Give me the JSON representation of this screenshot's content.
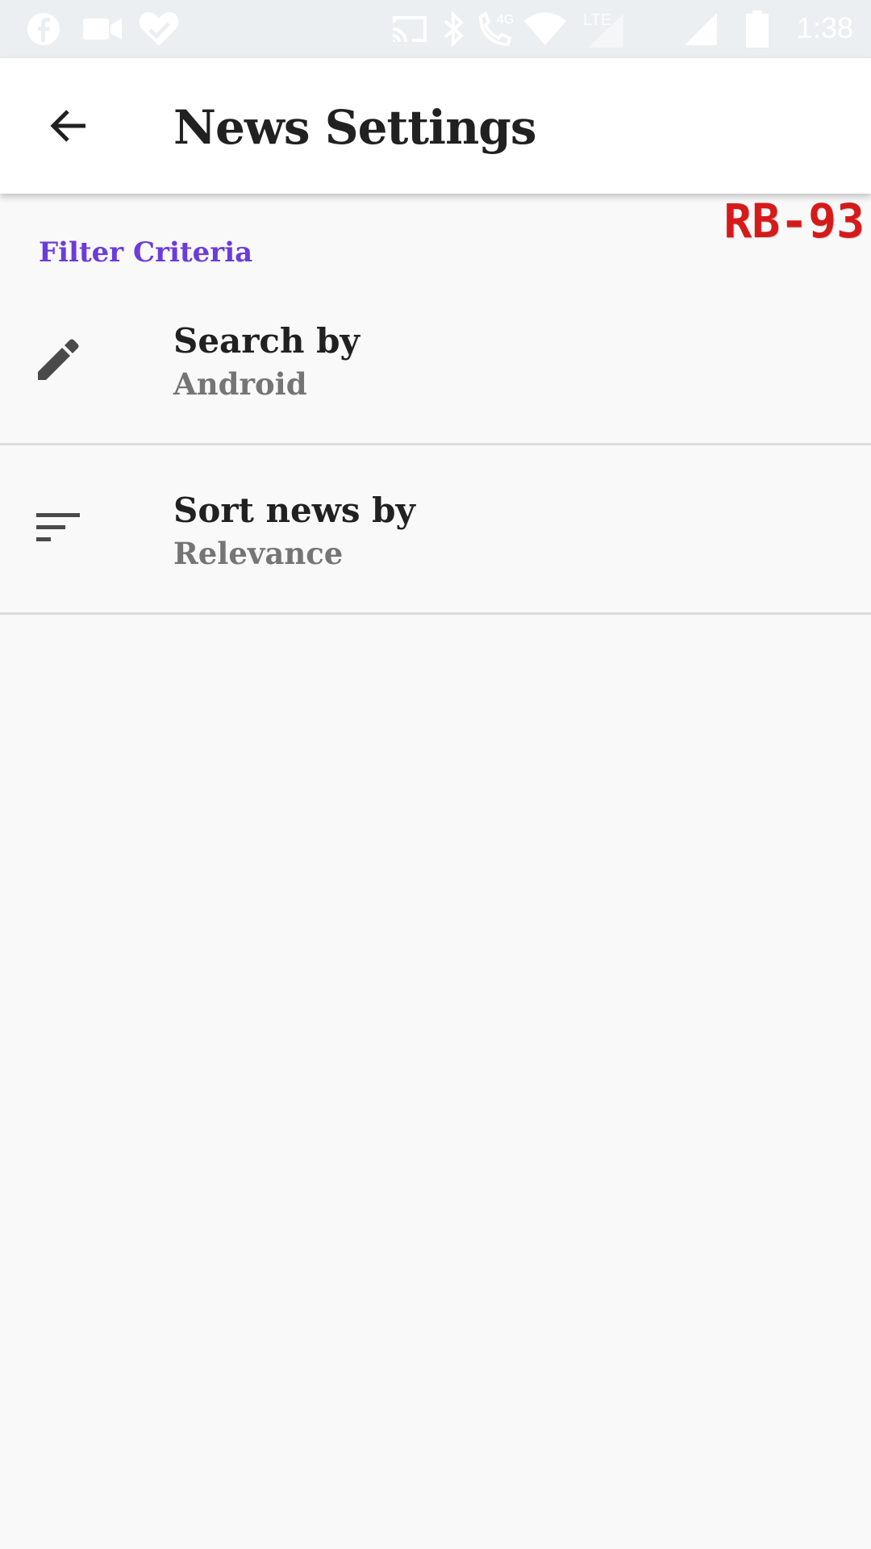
{
  "status_bar": {
    "time": "1:38",
    "network_label": "4G",
    "lte_label": "LTE",
    "icons": [
      "facebook-icon",
      "video-camera-icon",
      "heart-check-icon",
      "cast-icon",
      "bluetooth-icon",
      "wifi-calling-icon",
      "wifi-icon",
      "signal-icon",
      "signal-icon",
      "battery-icon"
    ]
  },
  "app_bar": {
    "title": "News Settings",
    "back_icon": "arrow-back-icon"
  },
  "watermark": "RB-93",
  "section": {
    "header": "Filter Criteria",
    "color": "#6b3cdb"
  },
  "preferences": [
    {
      "icon": "pencil-icon",
      "title": "Search by",
      "summary": "Android"
    },
    {
      "icon": "sort-icon",
      "title": "Sort news by",
      "summary": "Relevance"
    }
  ]
}
